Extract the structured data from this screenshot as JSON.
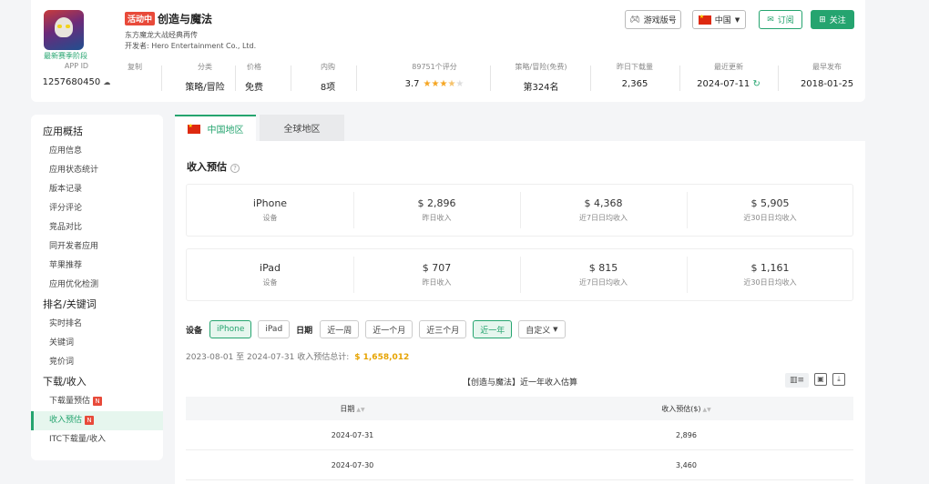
{
  "app": {
    "status_badge": "活动中",
    "name": "创造与魔法",
    "icon_caption": "最新赛季阶段",
    "subtitle": "东方魔龙大战经典再传",
    "developer": "开发者: Hero Entertainment Co., Ltd."
  },
  "header_buttons": {
    "game_version": "游戏版号",
    "region": "中国",
    "subscribe": "订阅",
    "follow": "关注"
  },
  "meta": [
    {
      "label": "APP ID",
      "value": "1257680450",
      "extra": "复制"
    },
    {
      "label": "分类",
      "value": "策略/冒险"
    },
    {
      "label": "价格",
      "value": "免费"
    },
    {
      "label": "内购",
      "value": "8项"
    },
    {
      "label": "89751个评分",
      "value": "3.7"
    },
    {
      "label": "策略/冒险(免费)",
      "value": "第324名"
    },
    {
      "label": "昨日下载量",
      "value": "2,365"
    },
    {
      "label": "最近更新",
      "value": "2024-07-11"
    },
    {
      "label": "最早发布",
      "value": "2018-01-25"
    }
  ],
  "rating_stars": 3.7,
  "sidebar": {
    "sections": [
      {
        "title": "应用概括",
        "items": [
          "应用信息",
          "应用状态统计",
          "版本记录",
          "评分评论",
          "竞品对比",
          "同开发者应用",
          "苹果推荐",
          "应用优化检测"
        ]
      },
      {
        "title": "排名/关键词",
        "items": [
          "实时排名",
          "关键词",
          "竞价词"
        ]
      },
      {
        "title": "下载/收入",
        "items": [
          "下载量预估",
          "收入预估",
          "ITC下载量/收入"
        ]
      }
    ],
    "badge": "N"
  },
  "region_tabs": {
    "china": "中国地区",
    "global": "全球地区"
  },
  "section_title": "收入预估",
  "help_glyph": "?",
  "stats": {
    "iphone": {
      "device": "iPhone",
      "device_label": "设备",
      "cells": [
        {
          "value": "$ 2,896",
          "label": "昨日收入"
        },
        {
          "value": "$ 4,368",
          "label": "近7日日均收入"
        },
        {
          "value": "$ 5,905",
          "label": "近30日日均收入"
        }
      ]
    },
    "ipad": {
      "device": "iPad",
      "device_label": "设备",
      "cells": [
        {
          "value": "$ 707",
          "label": "昨日收入"
        },
        {
          "value": "$ 815",
          "label": "近7日日均收入"
        },
        {
          "value": "$ 1,161",
          "label": "近30日日均收入"
        }
      ]
    }
  },
  "filters": {
    "device_label": "设备",
    "devices": [
      "iPhone",
      "iPad"
    ],
    "date_label": "日期",
    "ranges": [
      "近一周",
      "近一个月",
      "近三个月",
      "近一年",
      "自定义"
    ]
  },
  "range_summary": {
    "text": "2023-08-01 至 2024-07-31 收入预估总计:",
    "total": "$ 1,658,012"
  },
  "table": {
    "title": "【创造与魔法】近一年收入估算",
    "col_date": "日期",
    "col_revenue": "收入预估($)",
    "rows": [
      {
        "date": "2024-07-31",
        "revenue": "2,896"
      },
      {
        "date": "2024-07-30",
        "revenue": "3,460"
      }
    ]
  },
  "colors": {
    "accent": "#25a46f",
    "badge": "#e84a3a",
    "gold": "#e6a300"
  }
}
